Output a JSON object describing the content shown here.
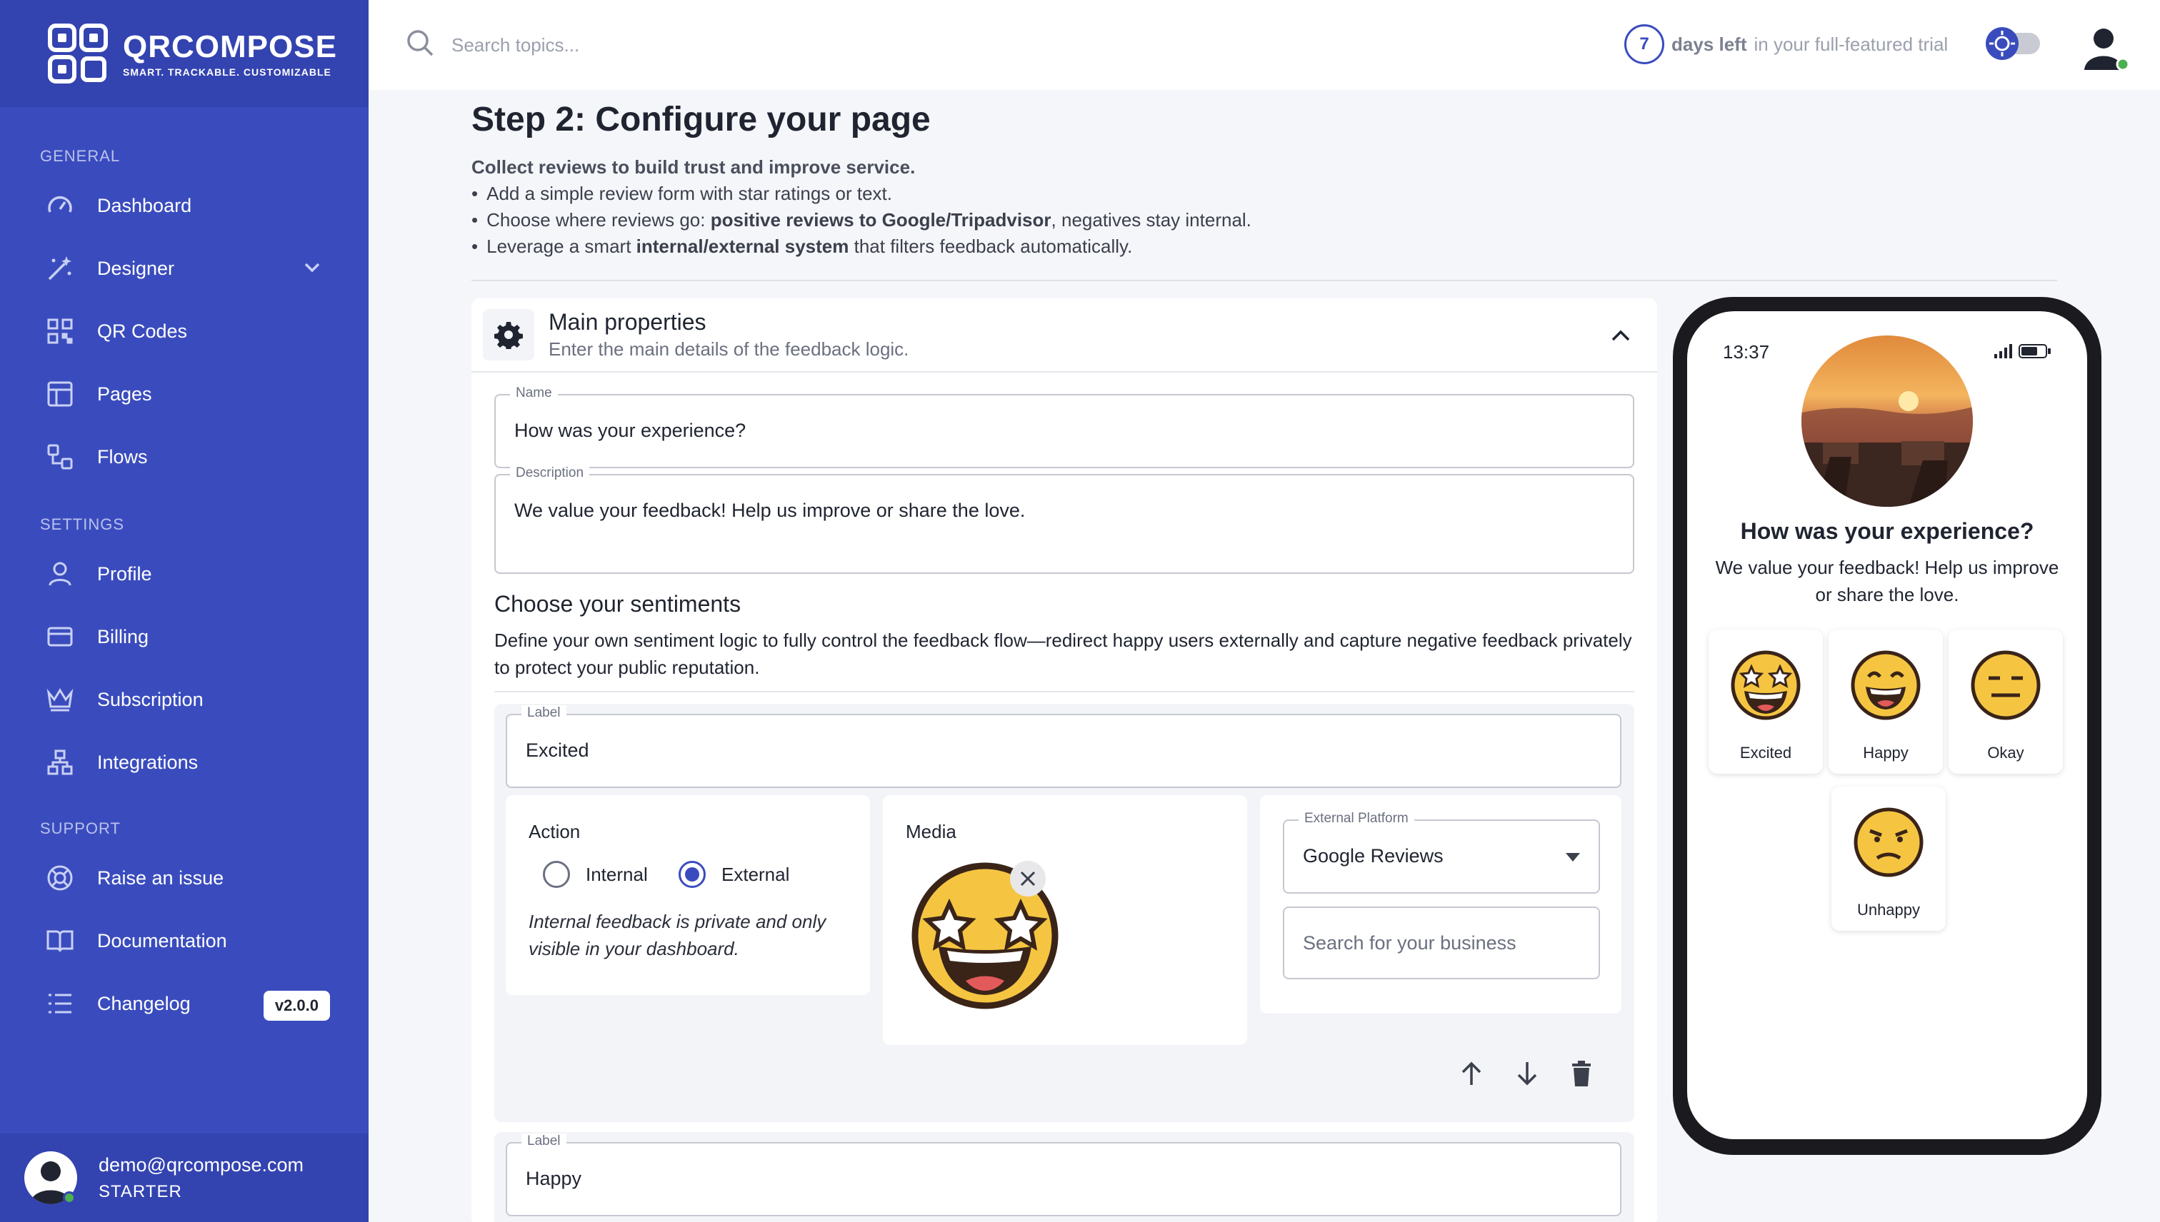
{
  "brand": {
    "name": "QRCOMPOSE",
    "tagline": "SMART. TRACKABLE. CUSTOMIZABLE"
  },
  "sidebar": {
    "sections": {
      "general": "GENERAL",
      "settings": "SETTINGS",
      "support": "SUPPORT"
    },
    "items": [
      {
        "label": "Dashboard",
        "icon": "gauge-icon"
      },
      {
        "label": "Designer",
        "icon": "magic-wand-icon"
      },
      {
        "label": "QR Codes",
        "icon": "qr-icon"
      },
      {
        "label": "Pages",
        "icon": "layout-icon"
      },
      {
        "label": "Flows",
        "icon": "flow-icon"
      },
      {
        "label": "Profile",
        "icon": "user-icon"
      },
      {
        "label": "Billing",
        "icon": "card-icon"
      },
      {
        "label": "Subscription",
        "icon": "crown-icon"
      },
      {
        "label": "Integrations",
        "icon": "integrations-icon"
      },
      {
        "label": "Raise an issue",
        "icon": "lifebuoy-icon"
      },
      {
        "label": "Documentation",
        "icon": "book-icon"
      },
      {
        "label": "Changelog",
        "icon": "list-icon"
      }
    ],
    "version_badge": "v2.0.0",
    "user": {
      "email": "demo@qrcompose.com",
      "plan": "STARTER"
    }
  },
  "topbar": {
    "search_placeholder": "Search topics...",
    "trial_days": "7",
    "trial_bold": "days left",
    "trial_rest": "in your full-featured trial"
  },
  "main": {
    "title": "Step 2: Configure your page",
    "lead": "Collect reviews to build trust and improve service.",
    "bullet1": "Add a simple review form with star ratings or text.",
    "bullet2_pre": "Choose where reviews go: ",
    "bullet2_bold": "positive reviews to Google/Tripadvisor",
    "bullet2_post": ", negatives stay internal.",
    "bullet3_pre": "Leverage a smart ",
    "bullet3_bold": "internal/external system",
    "bullet3_post": " that filters feedback automatically."
  },
  "panel": {
    "title": "Main properties",
    "subtitle": "Enter the main details of the feedback logic.",
    "name_label": "Name",
    "name_value": "How was your experience?",
    "description_label": "Description",
    "description_value": "We value your feedback! Help us improve or share the love.",
    "sentiments_title": "Choose your sentiments",
    "sentiments_desc": "Define your own sentiment logic to fully control the feedback flow—redirect happy users externally and capture negative feedback privately to protect your public reputation.",
    "sentiment1": {
      "label_caption": "Label",
      "label_value": "Excited",
      "action_title": "Action",
      "option_internal": "Internal",
      "option_external": "External",
      "selected": "External",
      "action_note": "Internal feedback is private and only visible in your dashboard.",
      "media_title": "Media",
      "platform_label": "External Platform",
      "platform_value": "Google Reviews",
      "business_placeholder": "Search for your business"
    },
    "sentiment2": {
      "label_caption": "Label",
      "label_value": "Happy"
    }
  },
  "preview": {
    "time": "13:37",
    "title": "How was your experience?",
    "description": "We value your feedback! Help us improve or share the love.",
    "options": [
      "Excited",
      "Happy",
      "Okay",
      "Unhappy"
    ]
  },
  "colors": {
    "accent": "#3a4cbd",
    "sidebar": "#3a4cbd",
    "emoji": "#f5c542"
  }
}
